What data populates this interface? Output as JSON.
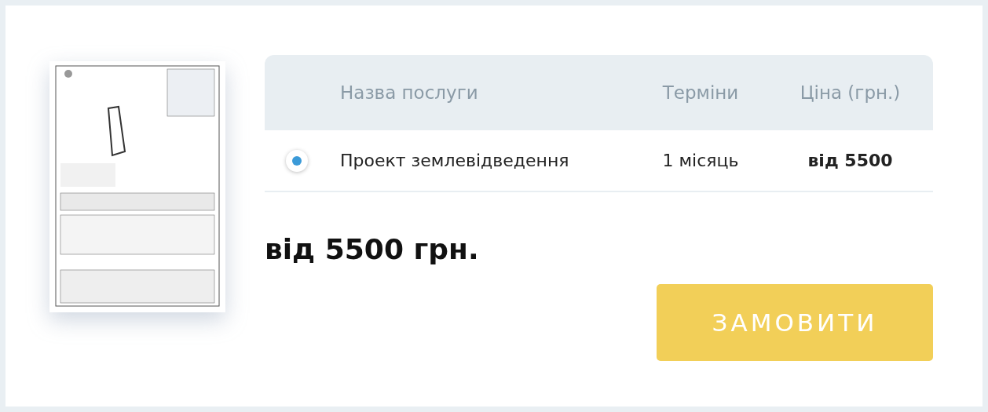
{
  "table": {
    "columns": [
      "Назва послуги",
      "Терміни",
      "Ціна (грн.)"
    ],
    "rows": [
      {
        "selected": true,
        "name": "Проект землевідведення",
        "term": "1 місяць",
        "price": "від 5500"
      }
    ]
  },
  "total": "від 5500 грн.",
  "order_button": "ЗАМОВИТИ"
}
